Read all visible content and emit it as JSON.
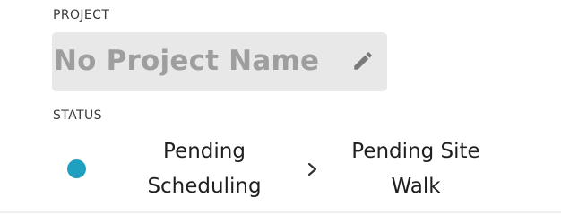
{
  "project": {
    "label": "PROJECT",
    "name": "No Project Name",
    "edit_icon": "pencil-icon"
  },
  "status": {
    "label": "STATUS",
    "dot_color": "#1fa0c0",
    "current_stage_line1": "Pending",
    "current_stage_line2": "Scheduling",
    "separator_icon": "chevron-right-icon",
    "next_stage_line1": "Pending Site",
    "next_stage_line2": "Walk"
  }
}
